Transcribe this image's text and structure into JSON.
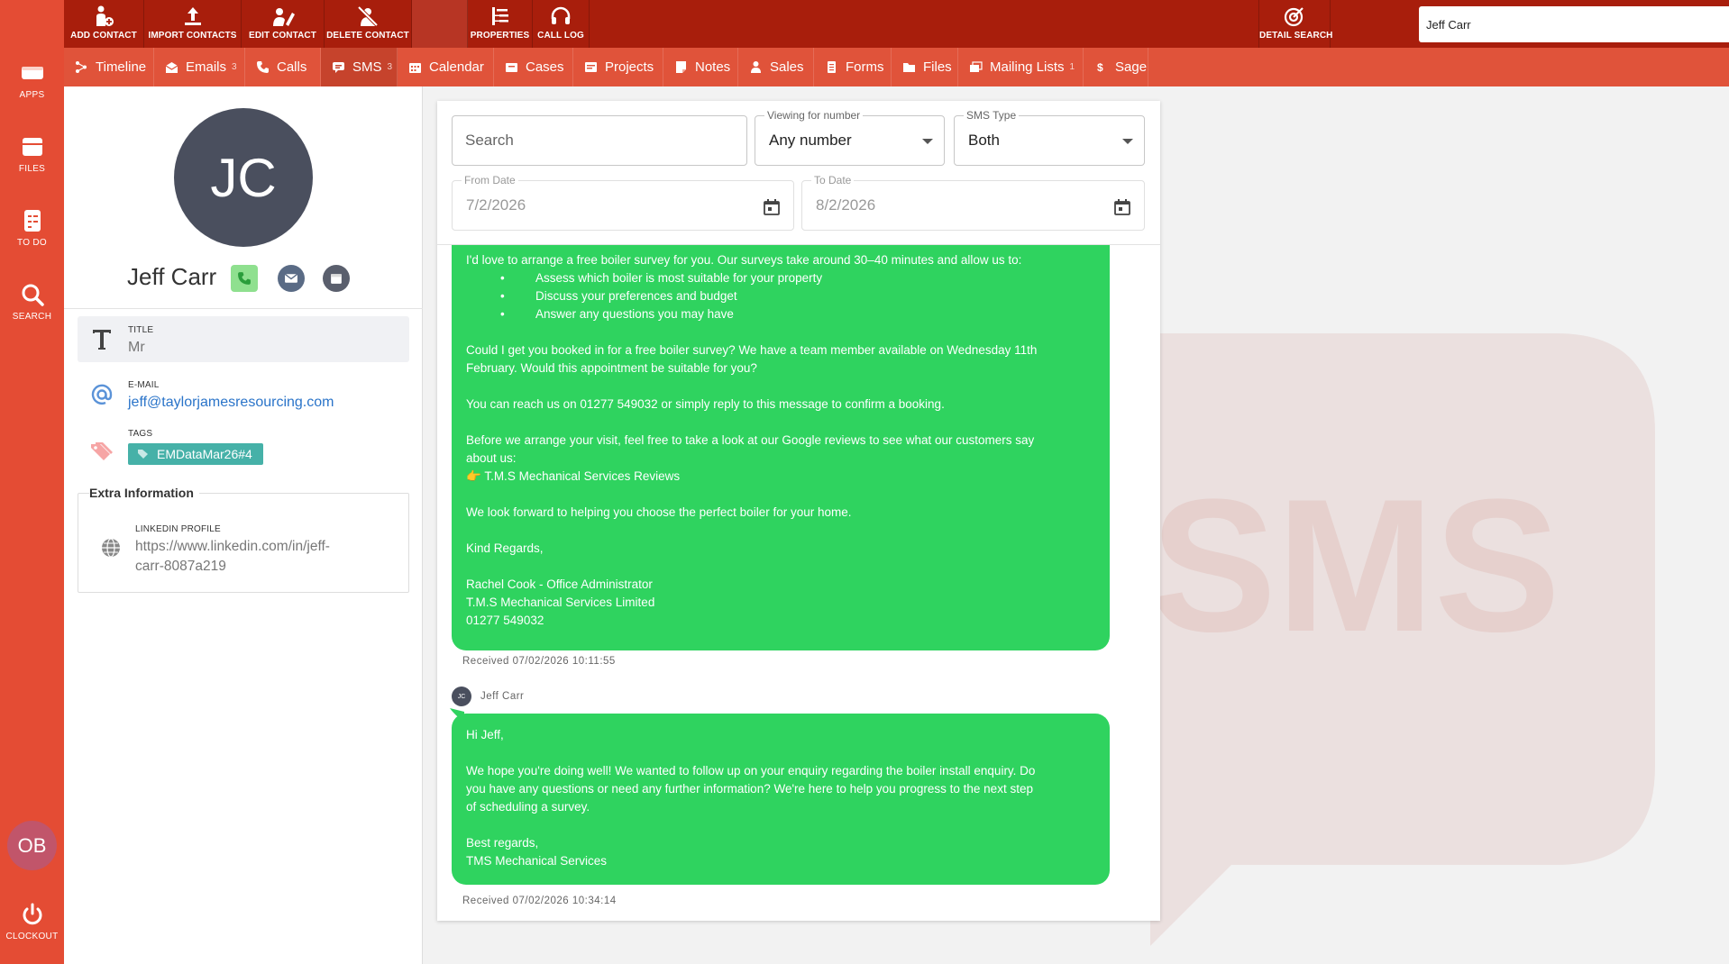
{
  "left_rail": {
    "items": [
      {
        "label": "APPS",
        "icon": "apps-icon"
      },
      {
        "label": "FILES",
        "icon": "files-icon"
      },
      {
        "label": "TO DO",
        "icon": "todo-icon"
      },
      {
        "label": "SEARCH",
        "icon": "search-icon"
      }
    ],
    "user_initials": "OB",
    "clockout_label": "CLOCKOUT"
  },
  "toolbar": {
    "buttons": [
      {
        "label": "ADD CONTACT",
        "icon": "add-contact-icon"
      },
      {
        "label": "IMPORT CONTACTS",
        "icon": "upload-icon"
      },
      {
        "label": "EDIT CONTACT",
        "icon": "edit-contact-icon"
      },
      {
        "label": "DELETE CONTACT",
        "icon": "delete-contact-icon"
      },
      {
        "label": "PROPERTIES",
        "icon": "properties-icon"
      },
      {
        "label": "CALL LOG",
        "icon": "headset-icon"
      }
    ],
    "detail_search_label": "DETAIL SEARCH",
    "search_value": "Jeff Carr"
  },
  "tabs": [
    {
      "label": "Timeline",
      "icon": "timeline-icon",
      "count": ""
    },
    {
      "label": "Emails",
      "icon": "email-icon",
      "count": "3"
    },
    {
      "label": "Calls",
      "icon": "phone-icon",
      "count": ""
    },
    {
      "label": "SMS",
      "icon": "sms-icon",
      "count": "3"
    },
    {
      "label": "Calendar",
      "icon": "calendar-icon",
      "count": ""
    },
    {
      "label": "Cases",
      "icon": "cases-icon",
      "count": ""
    },
    {
      "label": "Projects",
      "icon": "projects-icon",
      "count": ""
    },
    {
      "label": "Notes",
      "icon": "notes-icon",
      "count": ""
    },
    {
      "label": "Sales",
      "icon": "sales-icon",
      "count": ""
    },
    {
      "label": "Forms",
      "icon": "forms-icon",
      "count": ""
    },
    {
      "label": "Files",
      "icon": "folder-icon",
      "count": ""
    },
    {
      "label": "Mailing Lists",
      "icon": "mailing-list-icon",
      "count": "1"
    },
    {
      "label": "Sage",
      "icon": "sage-icon",
      "count": ""
    }
  ],
  "active_tab": "SMS",
  "contact": {
    "initials": "JC",
    "name": "Jeff Carr",
    "title_label": "TITLE",
    "title_value": "Mr",
    "email_label": "E-MAIL",
    "email_value": "jeff@taylorjamesresourcing.com",
    "tags_label": "TAGS",
    "tag": "EMDataMar26#4",
    "extra_info_title": "Extra Information",
    "linkedin_label": "LINKEDIN PROFILE",
    "linkedin_line1": "https://www.linkedin.com/in/jeff-",
    "linkedin_line2": "carr-8087a219"
  },
  "sms_filters": {
    "search_placeholder": "Search",
    "viewing_label": "Viewing for number",
    "viewing_value": "Any number",
    "type_label": "SMS Type",
    "type_value": "Both",
    "from_label": "From Date",
    "from_value": "7/2/2026",
    "to_label": "To Date",
    "to_value": "8/2/2026"
  },
  "messages": [
    {
      "intro": "I'd love to arrange a free boiler survey for you. Our surveys take around 30–40 minutes and allow us to:",
      "bullets": [
        "Assess which boiler is most suitable for your property",
        "Discuss your preferences and budget",
        "Answer any questions you may have"
      ],
      "p1": "Could I get you booked in for a free boiler survey? We have a team member available on Wednesday 11th\nFebruary. Would this appointment be suitable for you?",
      "p2": "You can reach us on 01277 549032 or simply reply to this message to confirm a booking.",
      "p3": "Before we arrange your visit, feel free to take a look at our Google reviews to see what our customers say\nabout us:\n👉 T.M.S Mechanical Services Reviews",
      "p4": "We look forward to helping you choose the perfect boiler for your home.",
      "p5": "Kind Regards,",
      "p6": "Rachel Cook - Office Administrator\nT.M.S Mechanical Services Limited\n01277 549032",
      "meta": "Received 07/02/2026 10:11:55"
    },
    {
      "sender_initials": "JC",
      "sender": "Jeff Carr",
      "p1": "Hi Jeff,",
      "p2": "We hope you're doing well! We wanted to follow up on your enquiry regarding the boiler install enquiry. Do\nyou have any questions or need any further information? We're here to help you progress to the next step\nof scheduling a survey.",
      "p3": "Best regards,\nTMS Mechanical Services",
      "meta": "Received 07/02/2026 10:34:14"
    }
  ],
  "colors": {
    "rail": "#e44c34",
    "toolbar": "#a81e0c",
    "tabbar": "#e0533a",
    "bubble": "#2fd35f",
    "avatar": "#4a4f5e",
    "tag": "#46b1a8"
  }
}
